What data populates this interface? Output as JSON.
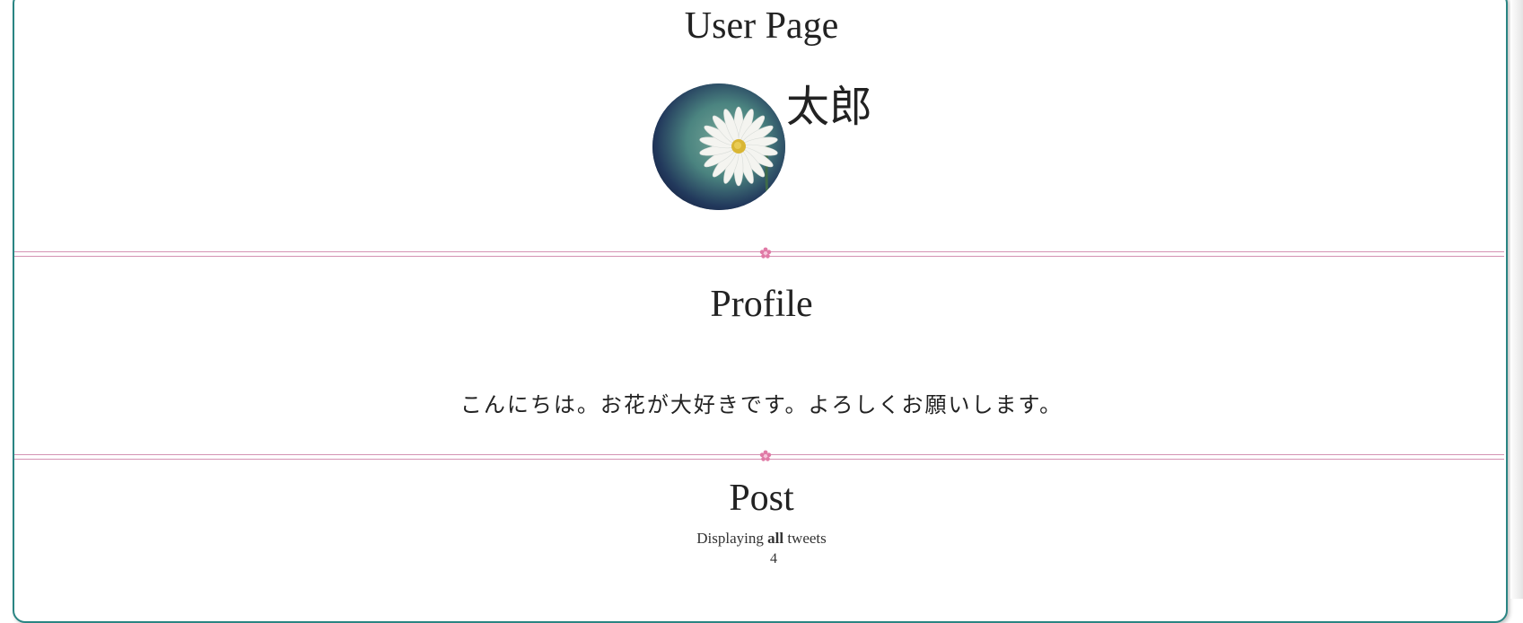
{
  "header": {
    "title": "User Page"
  },
  "user": {
    "name": "太郎",
    "avatar_alt": "daisy"
  },
  "profile": {
    "heading": "Profile",
    "bio": "こんにちは。お花が大好きです。よろしくお願いします。"
  },
  "posts": {
    "heading": "Post",
    "info_prefix": "Displaying ",
    "info_all": "all",
    "info_suffix": " tweets",
    "count": "4"
  },
  "colors": {
    "card_border": "#2a8583",
    "divider": "#d493b3",
    "text": "#222222"
  },
  "icons": {
    "divider_ornament": "flower-icon"
  }
}
